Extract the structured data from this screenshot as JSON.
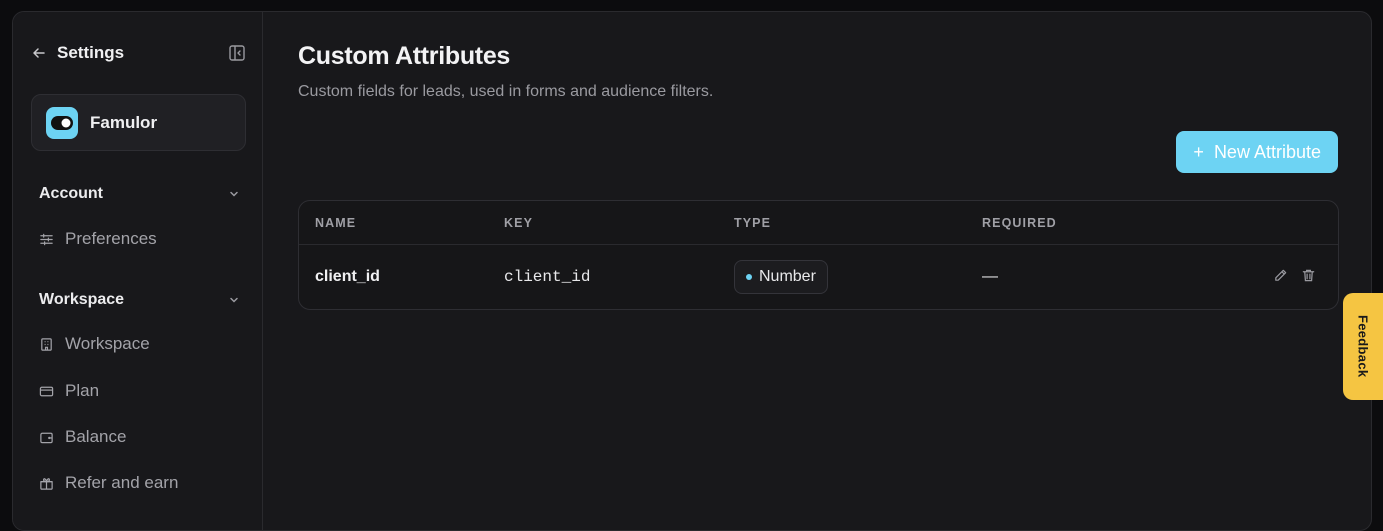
{
  "sidebar": {
    "title": "Settings",
    "org_name": "Famulor",
    "sections": [
      {
        "label": "Account",
        "items": [
          {
            "label": "Preferences",
            "icon": "sliders-icon"
          }
        ]
      },
      {
        "label": "Workspace",
        "items": [
          {
            "label": "Workspace",
            "icon": "building-icon"
          },
          {
            "label": "Plan",
            "icon": "credit-card-icon"
          },
          {
            "label": "Balance",
            "icon": "wallet-icon"
          },
          {
            "label": "Refer and earn",
            "icon": "gift-icon"
          }
        ]
      }
    ]
  },
  "main": {
    "title": "Custom Attributes",
    "subtitle": "Custom fields for leads, used in forms and audience filters.",
    "new_button": {
      "icon": "+",
      "label": "New Attribute"
    },
    "table": {
      "columns": [
        "NAME",
        "KEY",
        "TYPE",
        "REQUIRED"
      ],
      "rows": [
        {
          "name": "client_id",
          "key": "client_id",
          "type": "Number",
          "required": "—"
        }
      ]
    }
  },
  "feedback_tab": "Feedback",
  "colors": {
    "accent": "#6dd3f3",
    "feedback": "#f5c542",
    "background": "#18181b"
  }
}
